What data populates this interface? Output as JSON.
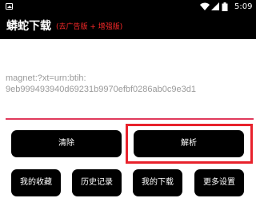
{
  "status_bar": {
    "time": "5:09",
    "icons": [
      "image-notification-icon",
      "wifi-icon",
      "cell-signal-icon",
      "battery-icon"
    ]
  },
  "app_bar": {
    "title": "蟒蛇下载",
    "subtitle": "(去广告版 + 增强版)"
  },
  "input": {
    "value": "magnet:?xt=urn:btih:\n9eb999493940d69231b9970efbf0286ab0c9e3d1"
  },
  "buttons": {
    "clear": "清除",
    "parse": "解析",
    "favorites": "我的收藏",
    "history": "历史记录",
    "downloads": "我的下载",
    "more_settings": "更多设置"
  },
  "colors": {
    "bar_background": "#000000",
    "subtitle": "#ff2a2a",
    "underline": "#e0395b",
    "highlight": "#e8222c",
    "hint_text": "#9a9a9a"
  }
}
